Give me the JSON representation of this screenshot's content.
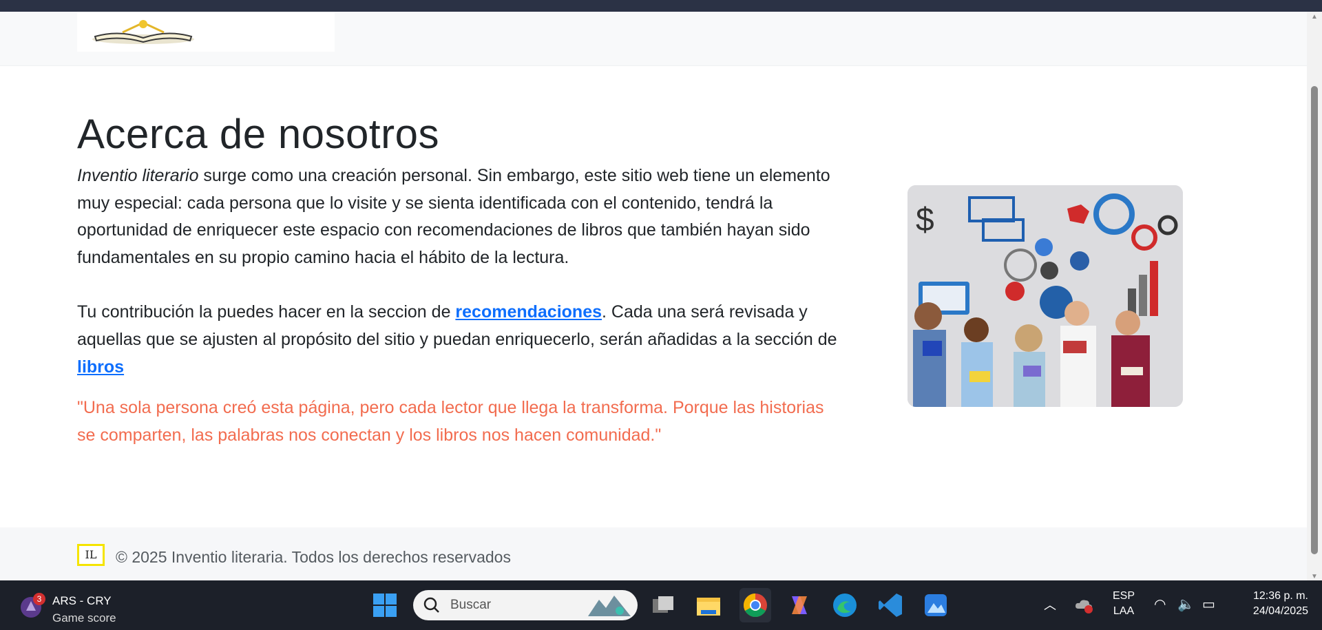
{
  "header": {
    "logo_alt": "book-logo"
  },
  "about": {
    "title": "Acerca de nosotros",
    "para1_italic": "Inventio literario",
    "para1_rest": " surge como una creación personal. Sin embargo, este sitio web tiene un elemento muy especial: cada persona que lo visite y se sienta identificada con el contenido, tendrá la oportunidad de enriquecer este espacio con recomendaciones de libros que también hayan sido fundamentales en su propio camino hacia el hábito de la lectura.",
    "para2_a": "Tu contribución la puedes hacer en la seccion de ",
    "link_recomendaciones": "recomendaciones",
    "para2_b": ". Cada una será revisada y aquellas que se ajusten al propósito del sitio y puedan enriquecerlo, serán añadidas a la sección de ",
    "link_libros": "libros",
    "quote": "\"Una sola persona creó esta página, pero cada lector que llega la transforma. Porque las historias se comparten, las palabras nos conectan y los libros nos hacen comunidad.\""
  },
  "footer": {
    "logo_text": "IL",
    "copyright": "© 2025 Inventio literaria. Todos los derechos reservados"
  },
  "taskbar": {
    "game_badge": "3",
    "game_title": "ARS - CRY",
    "game_subtitle": "Game score",
    "search_placeholder": "Buscar",
    "lang_top": "ESP",
    "lang_bottom": "LAA",
    "time": "12:36 p. m.",
    "date": "24/04/2025"
  },
  "colors": {
    "link": "#0d6efd",
    "quote": "#f26c4f",
    "taskbar": "#1c2029"
  }
}
